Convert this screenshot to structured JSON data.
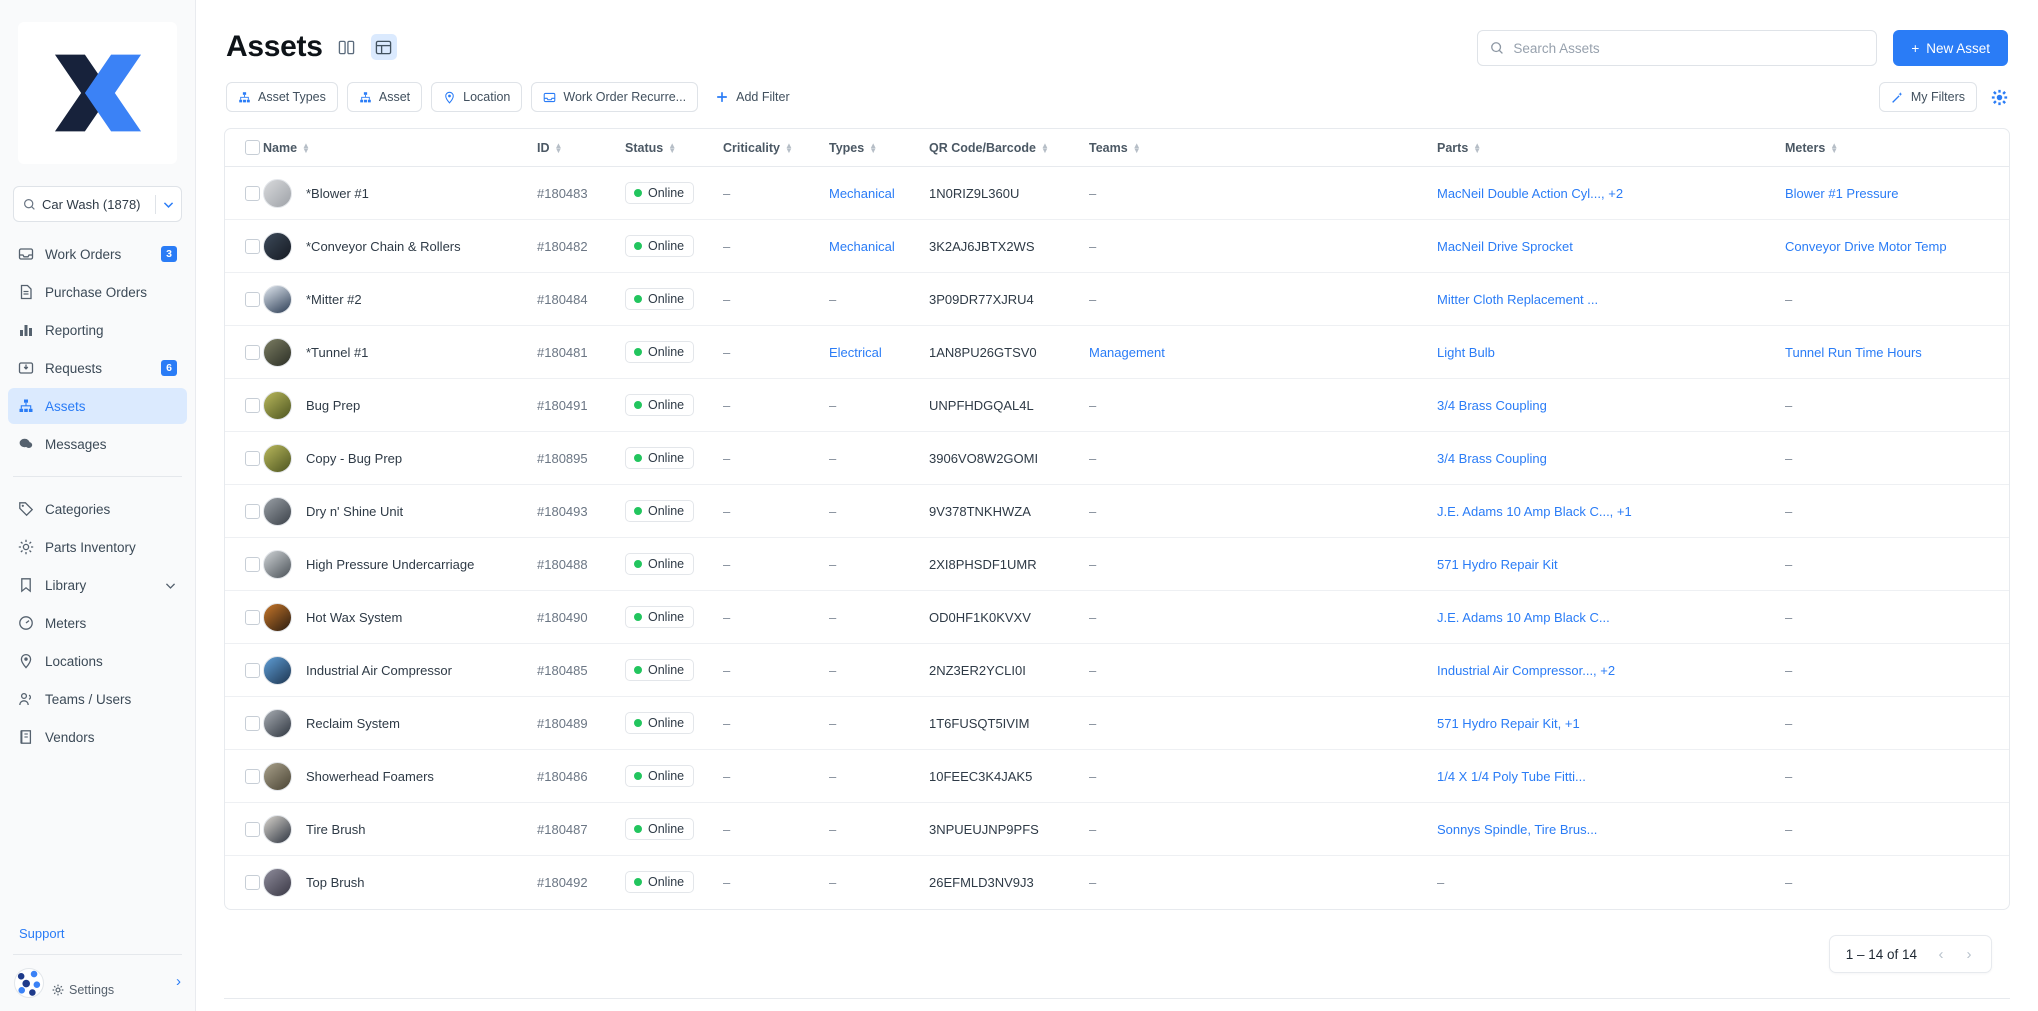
{
  "sidebar": {
    "logo_name": "x-logo",
    "site_selector": {
      "value": "Car Wash (1878)",
      "icon": "search-icon"
    },
    "items": [
      {
        "label": "Work Orders",
        "icon": "inbox-icon",
        "badge": "3",
        "active": false
      },
      {
        "label": "Purchase Orders",
        "icon": "document-icon",
        "badge": "",
        "active": false
      },
      {
        "label": "Reporting",
        "icon": "bar-chart-icon",
        "badge": "",
        "active": false
      },
      {
        "label": "Requests",
        "icon": "inbox-down-icon",
        "badge": "6",
        "active": false
      },
      {
        "label": "Assets",
        "icon": "sitemap-icon",
        "badge": "",
        "active": true
      },
      {
        "label": "Messages",
        "icon": "chat-icon",
        "badge": "",
        "active": false
      }
    ],
    "items2": [
      {
        "label": "Categories",
        "icon": "tag-icon",
        "chevron": false
      },
      {
        "label": "Parts Inventory",
        "icon": "gear-icon",
        "chevron": false
      },
      {
        "label": "Library",
        "icon": "bookmark-icon",
        "chevron": true
      },
      {
        "label": "Meters",
        "icon": "gauge-icon",
        "chevron": false
      },
      {
        "label": "Locations",
        "icon": "pin-icon",
        "chevron": false
      },
      {
        "label": "Teams / Users",
        "icon": "users-icon",
        "chevron": false
      },
      {
        "label": "Vendors",
        "icon": "building-icon",
        "chevron": false
      }
    ],
    "support_label": "Support",
    "settings_label": "Settings"
  },
  "header": {
    "title": "Assets",
    "view_toggles": [
      {
        "name": "split-view-icon",
        "active": false
      },
      {
        "name": "table-view-icon",
        "active": true
      }
    ],
    "search": {
      "placeholder": "Search Assets",
      "value": "",
      "icon": "search-icon"
    },
    "new_asset_label": "New Asset"
  },
  "filters": {
    "chips": [
      {
        "label": "Asset Types",
        "icon": "sitemap-icon"
      },
      {
        "label": "Asset",
        "icon": "sitemap-icon"
      },
      {
        "label": "Location",
        "icon": "pin-icon"
      },
      {
        "label": "Work Order Recurre...",
        "icon": "inbox-icon"
      }
    ],
    "add_filter_label": "Add Filter",
    "my_filters_label": "My Filters",
    "settings_gear": "gear-icon"
  },
  "table": {
    "columns": [
      {
        "key": "name",
        "label": "Name"
      },
      {
        "key": "id",
        "label": "ID"
      },
      {
        "key": "status",
        "label": "Status"
      },
      {
        "key": "crit",
        "label": "Criticality"
      },
      {
        "key": "types",
        "label": "Types"
      },
      {
        "key": "qr",
        "label": "QR Code/Barcode"
      },
      {
        "key": "teams",
        "label": "Teams"
      },
      {
        "key": "parts",
        "label": "Parts"
      },
      {
        "key": "meters",
        "label": "Meters"
      }
    ],
    "rows": [
      {
        "name": "*Blower #1",
        "id": "#180483",
        "status": "Online",
        "crit": "–",
        "types": "Mechanical",
        "qr": "1N0RIZ9L360U",
        "teams": "–",
        "parts": "MacNeil Double Action Cyl..., +2",
        "meters": "Blower #1 Pressure"
      },
      {
        "name": "*Conveyor Chain & Rollers",
        "id": "#180482",
        "status": "Online",
        "crit": "–",
        "types": "Mechanical",
        "qr": "3K2AJ6JBTX2WS",
        "teams": "–",
        "parts": "MacNeil Drive Sprocket",
        "meters": "Conveyor Drive Motor Temp"
      },
      {
        "name": "*Mitter #2",
        "id": "#180484",
        "status": "Online",
        "crit": "–",
        "types": "–",
        "qr": "3P09DR77XJRU4",
        "teams": "–",
        "parts": "Mitter Cloth Replacement ...",
        "meters": "–"
      },
      {
        "name": "*Tunnel #1",
        "id": "#180481",
        "status": "Online",
        "crit": "–",
        "types": "Electrical",
        "qr": "1AN8PU26GTSV0",
        "teams": "Management",
        "parts": "Light Bulb",
        "meters": "Tunnel Run Time Hours"
      },
      {
        "name": "Bug Prep",
        "id": "#180491",
        "status": "Online",
        "crit": "–",
        "types": "–",
        "qr": "UNPFHDGQAL4L",
        "teams": "–",
        "parts": "3/4 Brass Coupling",
        "meters": "–"
      },
      {
        "name": "Copy - Bug Prep",
        "id": "#180895",
        "status": "Online",
        "crit": "–",
        "types": "–",
        "qr": "3906VO8W2GOMI",
        "teams": "–",
        "parts": "3/4 Brass Coupling",
        "meters": "–"
      },
      {
        "name": "Dry n' Shine Unit",
        "id": "#180493",
        "status": "Online",
        "crit": "–",
        "types": "–",
        "qr": "9V378TNKHWZA",
        "teams": "–",
        "parts": "J.E. Adams 10 Amp Black C..., +1",
        "meters": "–"
      },
      {
        "name": "High Pressure Undercarriage",
        "id": "#180488",
        "status": "Online",
        "crit": "–",
        "types": "–",
        "qr": "2XI8PHSDF1UMR",
        "teams": "–",
        "parts": "571 Hydro Repair Kit",
        "meters": "–"
      },
      {
        "name": "Hot Wax System",
        "id": "#180490",
        "status": "Online",
        "crit": "–",
        "types": "–",
        "qr": "OD0HF1K0KVXV",
        "teams": "–",
        "parts": "J.E. Adams 10 Amp Black C...",
        "meters": "–"
      },
      {
        "name": "Industrial Air Compressor",
        "id": "#180485",
        "status": "Online",
        "crit": "–",
        "types": "–",
        "qr": "2NZ3ER2YCLI0I",
        "teams": "–",
        "parts": "Industrial Air Compressor..., +2",
        "meters": "–"
      },
      {
        "name": "Reclaim System",
        "id": "#180489",
        "status": "Online",
        "crit": "–",
        "types": "–",
        "qr": "1T6FUSQT5IVIM",
        "teams": "–",
        "parts": "571 Hydro Repair Kit, +1",
        "meters": "–"
      },
      {
        "name": "Showerhead Foamers",
        "id": "#180486",
        "status": "Online",
        "crit": "–",
        "types": "–",
        "qr": "10FEEC3K4JAK5",
        "teams": "–",
        "parts": "1/4 X 1/4 Poly Tube Fitti...",
        "meters": "–"
      },
      {
        "name": "Tire Brush",
        "id": "#180487",
        "status": "Online",
        "crit": "–",
        "types": "–",
        "qr": "3NPUEUJNP9PFS",
        "teams": "–",
        "parts": "Sonnys Spindle, Tire Brus...",
        "meters": "–"
      },
      {
        "name": "Top Brush",
        "id": "#180492",
        "status": "Online",
        "crit": "–",
        "types": "–",
        "qr": "26EFMLD3NV9J3",
        "teams": "–",
        "parts": "–",
        "meters": "–"
      }
    ]
  },
  "pagination": {
    "range_label": "1 – 14 of 14",
    "prev_icon": "chevron-left-icon",
    "next_icon": "chevron-right-icon"
  },
  "colors": {
    "accent": "#2a7cf6",
    "online": "#22c55e",
    "logo_dark": "#17223b",
    "logo_blue": "#3b82f6"
  }
}
